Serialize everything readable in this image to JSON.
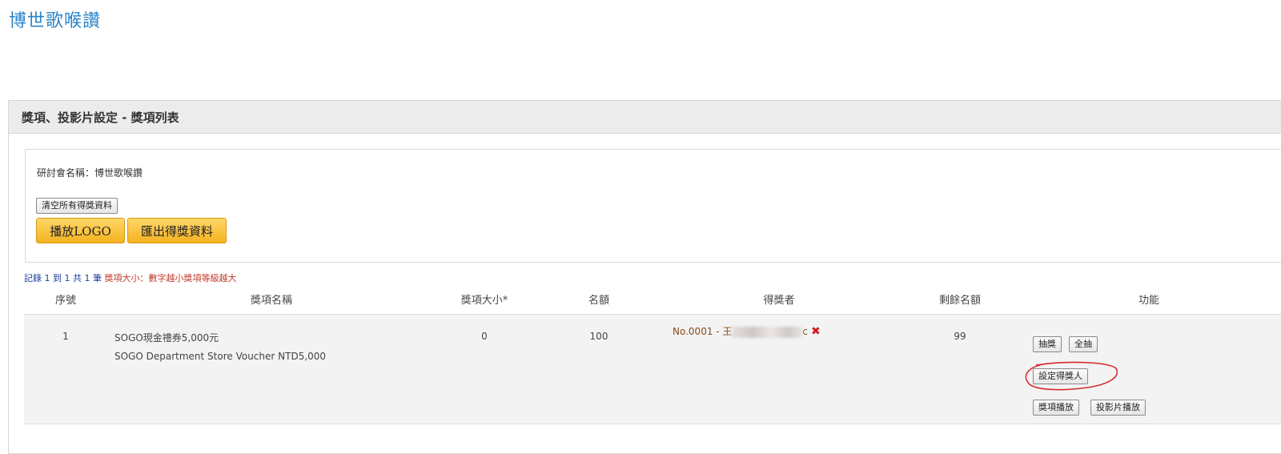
{
  "site_title": "博世歌喉讚",
  "panel": {
    "title": "獎項、投影片設定 - 獎項列表",
    "conference_label": "研討會名稱：",
    "conference_name": "博世歌喉讚",
    "clear_button": "清空所有得獎資料",
    "play_logo_button": "播放LOGO",
    "export_button": "匯出得獎資料"
  },
  "records": {
    "prefix": "記錄",
    "from": "1",
    "to_word": "到",
    "to": "1",
    "total_word": "共",
    "total": "1",
    "unit": "筆",
    "note": "獎項大小：數字越小獎項等級越大"
  },
  "table": {
    "headers": [
      "序號",
      "獎項名稱",
      "獎項大小*",
      "名額",
      "得獎者",
      "剩餘名額",
      "功能"
    ],
    "rows": [
      {
        "index": "1",
        "name_zh": "SOGO現金禮券5,000元",
        "name_en": "SOGO Department Store Voucher NTD5,000",
        "size": "0",
        "quota": "100",
        "winner_prefix": "No.0001 - 王",
        "winner_suffix": "c",
        "remaining": "99",
        "actions": {
          "draw": "抽獎",
          "draw_all": "全抽",
          "set_winner": "設定得獎人",
          "play_prize": "獎項播放",
          "play_slides": "投影片播放"
        }
      }
    ]
  },
  "colors": {
    "title_blue": "#2a84c6",
    "annotation_red": "#d42a2a"
  },
  "icons": {
    "remove_winner": "remove-x-icon"
  }
}
